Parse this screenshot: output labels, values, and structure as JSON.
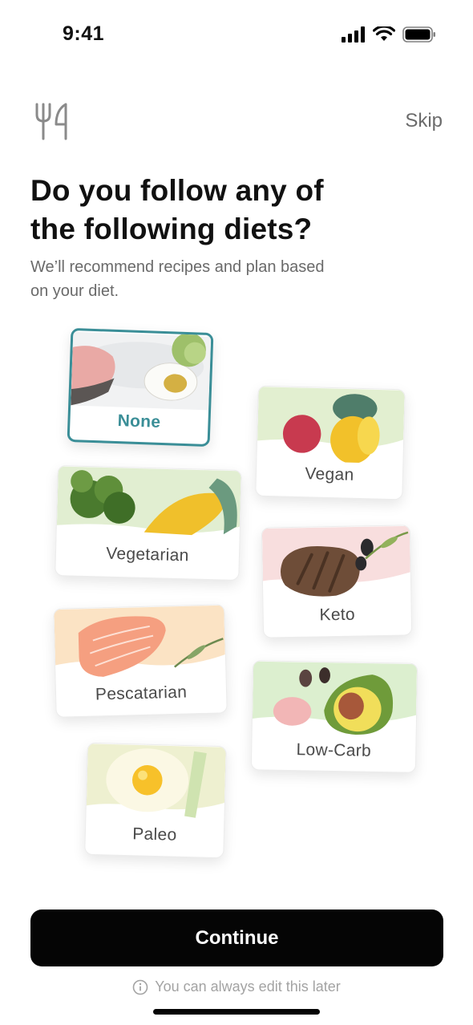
{
  "status_bar": {
    "time": "9:41"
  },
  "header": {
    "skip_label": "Skip",
    "logo_icon": "fork-knife-icon"
  },
  "intro": {
    "title": "Do you follow any of the following diets?",
    "subtitle": "We’ll recommend recipes and plan based on your diet."
  },
  "diets": {
    "none": {
      "label": "None",
      "selected": true
    },
    "vegan": {
      "label": "Vegan"
    },
    "vegetarian": {
      "label": "Vegetarian"
    },
    "keto": {
      "label": "Keto"
    },
    "pescatarian": {
      "label": "Pescatarian"
    },
    "low_carb": {
      "label": "Low-Carb"
    },
    "paleo": {
      "label": "Paleo"
    }
  },
  "footer": {
    "continue_label": "Continue",
    "hint": "You can always edit this later"
  },
  "colors": {
    "accent": "#3a8e97",
    "button": "#050505"
  }
}
